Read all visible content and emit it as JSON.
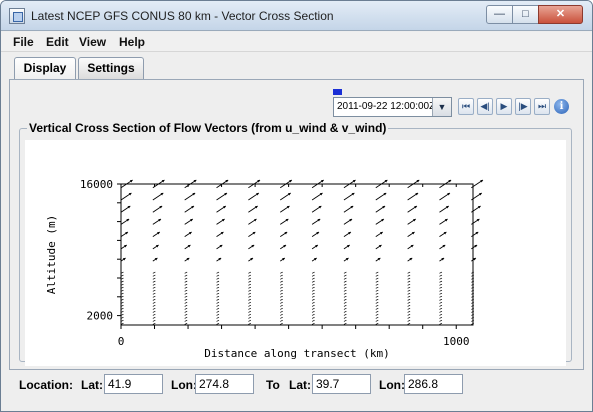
{
  "window": {
    "title": "Latest NCEP GFS CONUS 80 km - Vector Cross Section",
    "minimize_label": "—",
    "maximize_label": "□",
    "close_label": "✕"
  },
  "menu": [
    "File",
    "Edit",
    "View",
    "Help"
  ],
  "tabs": [
    {
      "label": "Display",
      "active": true
    },
    {
      "label": "Settings",
      "active": false
    }
  ],
  "time_control": {
    "selected": "2011-09-22 12:00:00Z",
    "marker_color": "#1a2fd6",
    "buttons": [
      {
        "name": "first-frame-button",
        "icon": "skip-backward-icon",
        "glyph": "⏮"
      },
      {
        "name": "step-back-button",
        "icon": "step-backward-icon",
        "glyph": "◀|"
      },
      {
        "name": "play-button",
        "icon": "play-icon",
        "glyph": "▶"
      },
      {
        "name": "step-forward-button",
        "icon": "step-forward-icon",
        "glyph": "|▶"
      },
      {
        "name": "last-frame-button",
        "icon": "skip-forward-icon",
        "glyph": "⏭"
      }
    ],
    "info_glyph": "i"
  },
  "section_title": "Vertical Cross Section of Flow Vectors (from u_wind & v_wind)",
  "chart_data": {
    "type": "vector-field",
    "title": "",
    "xlabel": "Distance along transect (km)",
    "ylabel": "Altitude (m)",
    "x_ticks": [
      0,
      1000
    ],
    "y_ticks": [
      2000,
      16000
    ],
    "xlim": [
      0,
      1050
    ],
    "ylim": [
      1000,
      16000
    ],
    "columns_km": [
      0,
      95,
      190,
      285,
      380,
      475,
      570,
      665,
      760,
      855,
      950,
      1045
    ],
    "vector_color": "#000000"
  },
  "location": {
    "label": "Location:",
    "from_lat_label": "Lat:",
    "from_lat": "41.9",
    "from_lon_label": "Lon:",
    "from_lon": "274.8",
    "to_label": "To",
    "to_lat_label": "Lat:",
    "to_lat": "39.7",
    "to_lon_label": "Lon:",
    "to_lon": "286.8"
  }
}
